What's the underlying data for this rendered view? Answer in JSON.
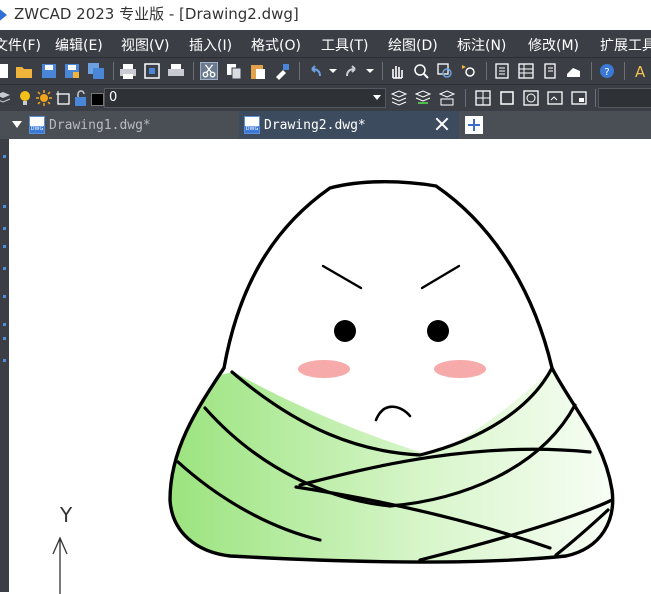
{
  "window": {
    "title": "ZWCAD 2023 专业版 - [Drawing2.dwg]"
  },
  "menu": [
    "文件(F)",
    "编辑(E)",
    "视图(V)",
    "插入(I)",
    "格式(O)",
    "工具(T)",
    "绘图(D)",
    "标注(N)",
    "修改(M)",
    "扩展工具"
  ],
  "layer": {
    "current": "0"
  },
  "tabs": [
    {
      "label": "Drawing1.dwg*"
    },
    {
      "label": "Drawing2.dwg*"
    }
  ],
  "ucs": {
    "y_label": "Y"
  },
  "colors": {
    "chrome": "#3b3f45",
    "active_tab": "#3d4b5e",
    "wrap_green": "#9be57a",
    "blush_pink": "#f6aaaa"
  }
}
